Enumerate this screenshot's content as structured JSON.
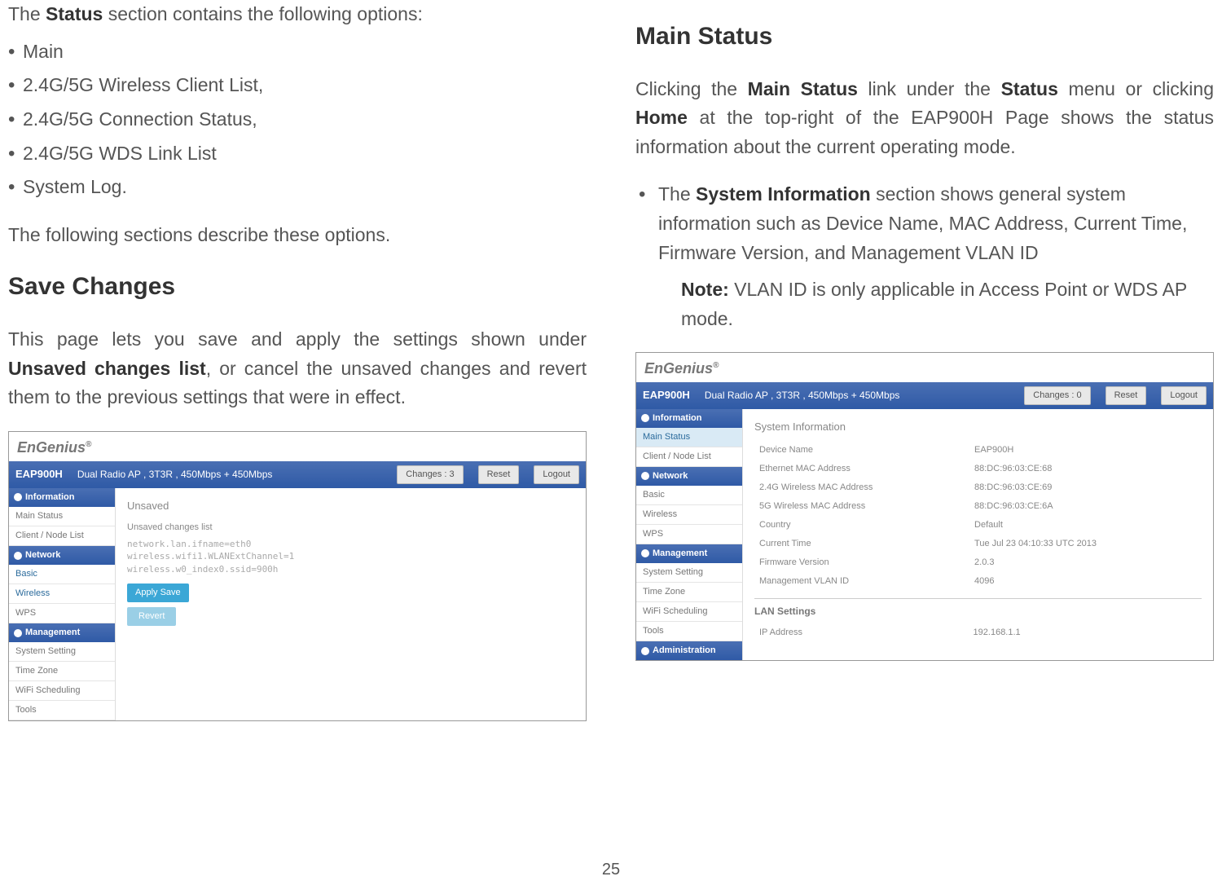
{
  "page_number": "25",
  "left": {
    "intro_prefix": "The ",
    "intro_bold": "Status",
    "intro_suffix": " section contains the following options:",
    "bullets": [
      "Main",
      "2.4G/5G Wireless Client List,",
      "2.4G/5G Connection Status,",
      "2.4G/5G WDS Link List",
      "System Log."
    ],
    "line2": "The following sections describe these options.",
    "h2": "Save Changes",
    "para_a": "This page lets you save and apply the settings shown under ",
    "para_bold": "Unsaved changes list",
    "para_b": ", or cancel the unsaved changes and revert them to the previous settings that were in effect."
  },
  "right": {
    "h2": "Main Status",
    "p1_a": "Clicking the ",
    "p1_b": "Main Status",
    "p1_c": " link under the ",
    "p1_d": "Status",
    "p1_e": " menu or clicking ",
    "p1_f": "Home",
    "p1_g": " at the top-right of the EAP900H Page shows the status information about the current operating mode.",
    "bullet_a": "The ",
    "bullet_b": "System Information",
    "bullet_c": " section shows general system information such as Device Name, MAC Address, Current Time, Firmware Version, and Management VLAN ID",
    "note_label": "Note:",
    "note_text": "  VLAN ID is only applicable in Access Point or WDS AP mode."
  },
  "ss1": {
    "logo": "EnGenius",
    "model": "EAP900H",
    "desc": "Dual Radio AP , 3T3R , 450Mbps + 450Mbps",
    "changes": "Changes : 3",
    "reset": "Reset",
    "logout": "Logout",
    "sec_info": "Information",
    "item_main": "Main Status",
    "item_client": "Client / Node List",
    "sec_net": "Network",
    "item_basic": "Basic",
    "item_wireless": "Wireless",
    "item_wps": "WPS",
    "sec_mgmt": "Management",
    "item_sys": "System Setting",
    "item_tz": "Time Zone",
    "item_wifi": "WiFi Scheduling",
    "item_tools": "Tools",
    "main_title": "Unsaved",
    "sub": "Unsaved changes list",
    "code": "network.lan.ifname=eth0\nwireless.wifi1.WLANExtChannel=1\nwireless.w0_index0.ssid=900h",
    "apply": "Apply Save",
    "revert": "Revert"
  },
  "ss2": {
    "logo": "EnGenius",
    "model": "EAP900H",
    "desc": "Dual Radio AP , 3T3R , 450Mbps + 450Mbps",
    "changes": "Changes : 0",
    "reset": "Reset",
    "logout": "Logout",
    "sec_info": "Information",
    "item_main": "Main Status",
    "item_client": "Client / Node List",
    "sec_net": "Network",
    "item_basic": "Basic",
    "item_wireless": "Wireless",
    "item_wps": "WPS",
    "sec_mgmt": "Management",
    "item_sys": "System Setting",
    "item_tz": "Time Zone",
    "item_wifi": "WiFi Scheduling",
    "item_tools": "Tools",
    "sec_admin": "Administration",
    "main_title": "System Information",
    "rows": [
      [
        "Device Name",
        "EAP900H"
      ],
      [
        "Ethernet MAC Address",
        "88:DC:96:03:CE:68"
      ],
      [
        "2.4G Wireless MAC Address",
        "88:DC:96:03:CE:69"
      ],
      [
        "5G Wireless MAC Address",
        "88:DC:96:03:CE:6A"
      ],
      [
        "Country",
        "Default"
      ],
      [
        "Current Time",
        "Tue Jul 23 04:10:33 UTC 2013"
      ],
      [
        "Firmware Version",
        "2.0.3"
      ],
      [
        "Management VLAN ID",
        "4096"
      ]
    ],
    "lan_title": "LAN Settings",
    "lan_label": "IP Address",
    "lan_val": "192.168.1.1"
  }
}
